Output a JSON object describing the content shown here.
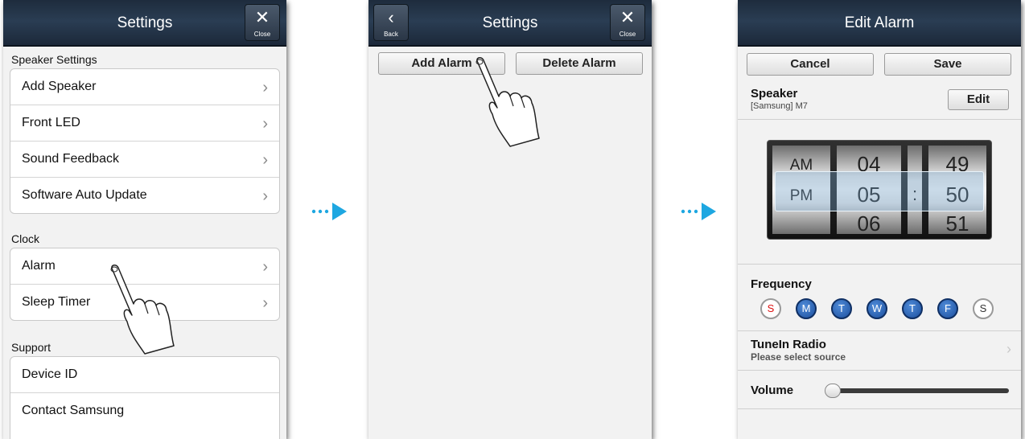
{
  "screen1": {
    "title": "Settings",
    "close_label": "Close",
    "sections": [
      {
        "header": "Speaker Settings",
        "items": [
          "Add Speaker",
          "Front LED",
          "Sound Feedback",
          "Software Auto Update"
        ]
      },
      {
        "header": "Clock",
        "items": [
          "Alarm",
          "Sleep Timer"
        ]
      },
      {
        "header": "Support",
        "items": [
          "Device ID",
          "Contact Samsung"
        ]
      }
    ]
  },
  "screen2": {
    "title": "Settings",
    "back_label": "Back",
    "close_label": "Close",
    "add_alarm": "Add Alarm",
    "delete_alarm": "Delete Alarm"
  },
  "screen3": {
    "title": "Edit Alarm",
    "cancel": "Cancel",
    "save": "Save",
    "speaker_label": "Speaker",
    "speaker_value": "[Samsung] M7",
    "edit": "Edit",
    "time_picker": {
      "ampm": [
        "AM",
        "PM"
      ],
      "hours": [
        "04",
        "05",
        "06"
      ],
      "minutes": [
        "49",
        "50",
        "51"
      ],
      "separator": ":",
      "selected": {
        "ampm": "PM",
        "hour": "05",
        "minute": "50"
      }
    },
    "frequency_label": "Frequency",
    "days": [
      {
        "letter": "S",
        "selected": false
      },
      {
        "letter": "M",
        "selected": true
      },
      {
        "letter": "T",
        "selected": true
      },
      {
        "letter": "W",
        "selected": true
      },
      {
        "letter": "T",
        "selected": true
      },
      {
        "letter": "F",
        "selected": true
      },
      {
        "letter": "S",
        "selected": false
      }
    ],
    "source_title": "TuneIn Radio",
    "source_sub": "Please select source",
    "volume_label": "Volume",
    "volume_level": 0.0
  },
  "colors": {
    "accent": "#1ea7e1",
    "day_selected": "#1c4f9e",
    "sunday": "#d11111"
  }
}
